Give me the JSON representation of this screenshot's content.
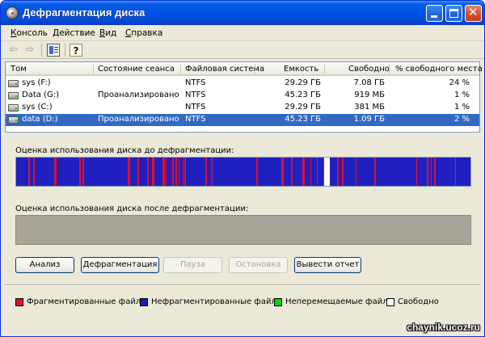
{
  "window": {
    "title": "Дефрагментация диска"
  },
  "menu": [
    {
      "label": "Консоль",
      "accel": "К"
    },
    {
      "label": "Действие",
      "accel": "Д"
    },
    {
      "label": "Вид",
      "accel": "В"
    },
    {
      "label": "Справка",
      "accel": "С"
    }
  ],
  "toolbar": {
    "back_icon": "back-arrow-icon",
    "forward_icon": "forward-arrow-icon",
    "console_icon": "console-tree-icon",
    "help_icon": "help-icon"
  },
  "table": {
    "columns": [
      "Том",
      "Состояние сеанса",
      "Файловая система",
      "Емкость",
      "Свободно",
      "% свободного места"
    ],
    "rows": [
      {
        "volume": "sys (F:)",
        "status": "",
        "fs": "NTFS",
        "capacity": "29.29 ГБ",
        "free": "7.08 ГБ",
        "pct": "24 %",
        "selected": false
      },
      {
        "volume": "Data (G:)",
        "status": "Проанализировано",
        "fs": "NTFS",
        "capacity": "45.23 ГБ",
        "free": "919 МБ",
        "pct": "1 %",
        "selected": false
      },
      {
        "volume": "sys (C:)",
        "status": "",
        "fs": "NTFS",
        "capacity": "29.29 ГБ",
        "free": "381 МБ",
        "pct": "1 %",
        "selected": false
      },
      {
        "volume": "data (D:)",
        "status": "Проанализировано",
        "fs": "NTFS",
        "capacity": "45.23 ГБ",
        "free": "1.09 ГБ",
        "pct": "2 %",
        "selected": true
      }
    ]
  },
  "analysis": {
    "before_label": "Оценка использования диска до дефрагментации:",
    "after_label": "Оценка использования диска после дефрагментации:"
  },
  "buttons": {
    "analyze": "Анализ",
    "defrag": "Дефрагментация",
    "pause": "Пауза",
    "stop": "Остановка",
    "report": "Вывести отчет"
  },
  "legend": [
    {
      "label": "Фрагментированные файлы",
      "color": "#e0102a"
    },
    {
      "label": "Нефрагментированные файлы",
      "color": "#1818c8"
    },
    {
      "label": "Неперемещаемые файлы",
      "color": "#10d010"
    },
    {
      "label": "Свободно",
      "color": "#ffffff"
    }
  ],
  "colors": {
    "fragmented": "#e0102a",
    "contiguous": "#2020c0",
    "free": "#ffffff"
  },
  "watermark": "chaynik.ucoz.ru"
}
